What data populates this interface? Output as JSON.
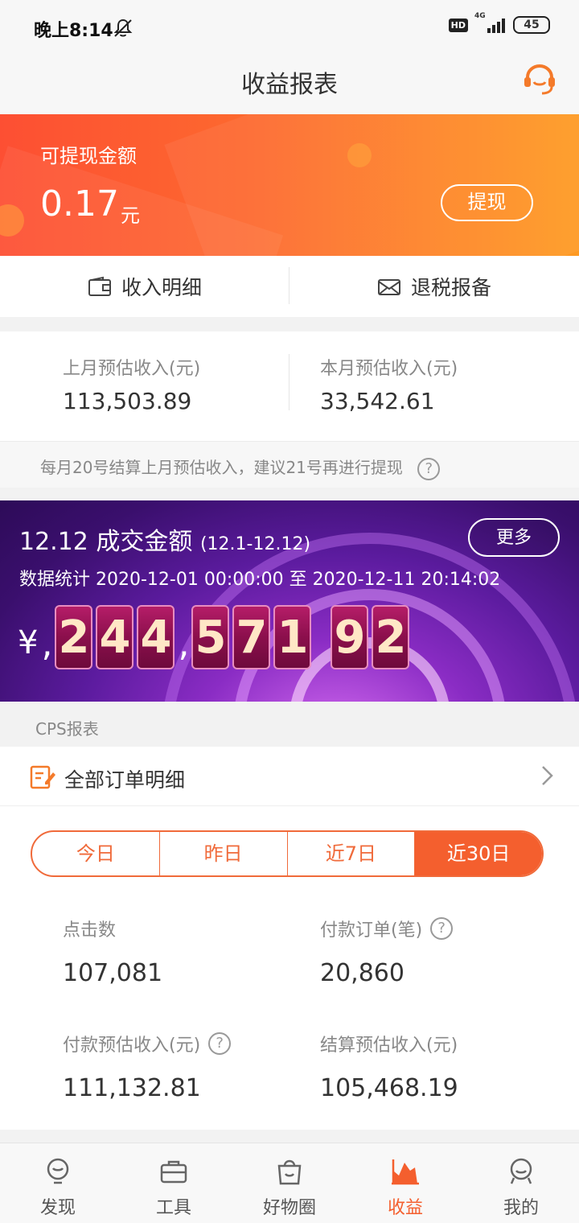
{
  "status_bar": {
    "time": "晚上8:14",
    "hd": "HD",
    "network": "4G",
    "battery": "45"
  },
  "header": {
    "title": "收益报表",
    "service_icon": "customer-service-icon"
  },
  "balance": {
    "label": "可提现金额",
    "amount": "0.17",
    "unit": "元",
    "withdraw_label": "提现"
  },
  "quick_actions": [
    {
      "label": "收入明细",
      "icon": "wallet-icon"
    },
    {
      "label": "退税报备",
      "icon": "mail-icon"
    }
  ],
  "monthly": {
    "last_month": {
      "label": "上月预估收入(元)",
      "value": "113,503.89"
    },
    "this_month": {
      "label": "本月预估收入(元)",
      "value": "33,542.61"
    }
  },
  "notice": {
    "text": "每月20号结算上月预估收入，建议21号再进行提现",
    "help_icon": "?"
  },
  "promo": {
    "title": "12.12 成交金额",
    "range": "(12.1-12.12)",
    "more_label": "更多",
    "stats_line": "数据统计 2020-12-01 00:00:00 至 2020-12-11 20:14:02",
    "currency": "¥",
    "sep": ",",
    "digits": [
      "2",
      "4",
      "4",
      "5",
      "7",
      "1",
      "9",
      "2"
    ]
  },
  "cps": {
    "section_title": "CPS报表",
    "all_orders_label": "全部订单明细",
    "tabs": [
      {
        "label": "今日",
        "active": false
      },
      {
        "label": "昨日",
        "active": false
      },
      {
        "label": "近7日",
        "active": false
      },
      {
        "label": "近30日",
        "active": true
      }
    ],
    "stats": {
      "clicks": {
        "label": "点击数",
        "value": "107,081"
      },
      "paid_orders": {
        "label": "付款订单(笔)",
        "value": "20,860"
      },
      "paid_income": {
        "label": "付款预估收入(元)",
        "value": "111,132.81"
      },
      "settled_income": {
        "label": "结算预估收入(元)",
        "value": "105,468.19"
      }
    }
  },
  "tab_bar": [
    {
      "label": "发现",
      "icon": "bulb-icon",
      "active": false
    },
    {
      "label": "工具",
      "icon": "toolbox-icon",
      "active": false
    },
    {
      "label": "好物圈",
      "icon": "bag-icon",
      "active": false
    },
    {
      "label": "收益",
      "icon": "chart-icon",
      "active": true
    },
    {
      "label": "我的",
      "icon": "profile-icon",
      "active": false
    }
  ],
  "colors": {
    "accent": "#f45f2e",
    "banner_start": "#fd4f33",
    "banner_end": "#fe9a22",
    "promo_purple": "#5b1b9e"
  }
}
